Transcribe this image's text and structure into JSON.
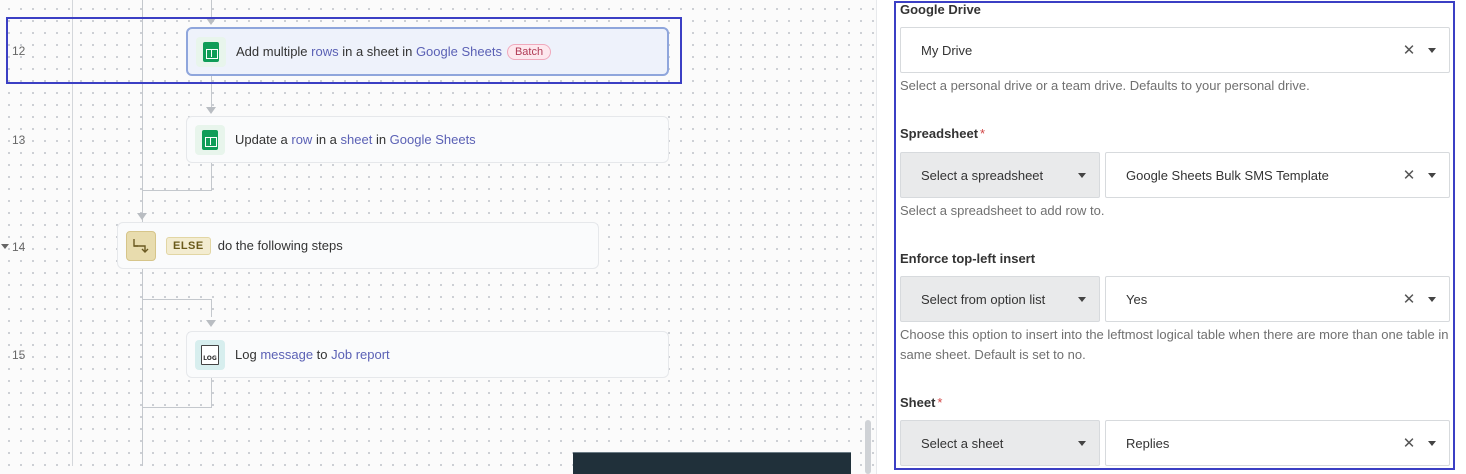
{
  "canvas": {
    "steps": [
      {
        "line": "12",
        "parts": [
          {
            "text": "Add multiple ",
            "kw": false
          },
          {
            "text": "rows",
            "kw": true
          },
          {
            "text": " in a sheet in ",
            "kw": false
          },
          {
            "text": "Google Sheets",
            "kw": true
          }
        ],
        "badge": "Batch"
      },
      {
        "line": "13",
        "parts": [
          {
            "text": "Update a ",
            "kw": false
          },
          {
            "text": "row",
            "kw": true
          },
          {
            "text": " in a ",
            "kw": false
          },
          {
            "text": "sheet",
            "kw": true
          },
          {
            "text": " in ",
            "kw": false
          },
          {
            "text": "Google Sheets",
            "kw": true
          }
        ]
      },
      {
        "line": "14",
        "keyword": "ELSE",
        "parts": [
          {
            "text": "do the following steps",
            "kw": false
          }
        ]
      },
      {
        "line": "15",
        "icon_text": "LOG",
        "parts": [
          {
            "text": "Log ",
            "kw": false
          },
          {
            "text": "message",
            "kw": true
          },
          {
            "text": " to ",
            "kw": false
          },
          {
            "text": "Job report",
            "kw": true
          }
        ]
      }
    ]
  },
  "panel": {
    "google_drive": {
      "label": "Google Drive",
      "value": "My Drive",
      "hint": "Select a personal drive or a team drive. Defaults to your personal drive."
    },
    "spreadsheet": {
      "label": "Spreadsheet",
      "required": "*",
      "mode": "Select a spreadsheet",
      "value": "Google Sheets Bulk SMS Template",
      "hint": "Select a spreadsheet to add row to."
    },
    "enforce": {
      "label": "Enforce top-left insert",
      "mode": "Select from option list",
      "value": "Yes",
      "hint": "Choose this option to insert into the leftmost logical table when there are more than one table in same sheet. Default is set to no."
    },
    "sheet": {
      "label": "Sheet",
      "required": "*",
      "mode": "Select a sheet",
      "value": "Replies"
    },
    "clear_glyph": "✕"
  },
  "colors": {
    "selection_outline": "#3b3fc4",
    "keyword_link": "#5b61b5",
    "sheets_green": "#0f9d58",
    "batch_badge": "#b03a55"
  }
}
